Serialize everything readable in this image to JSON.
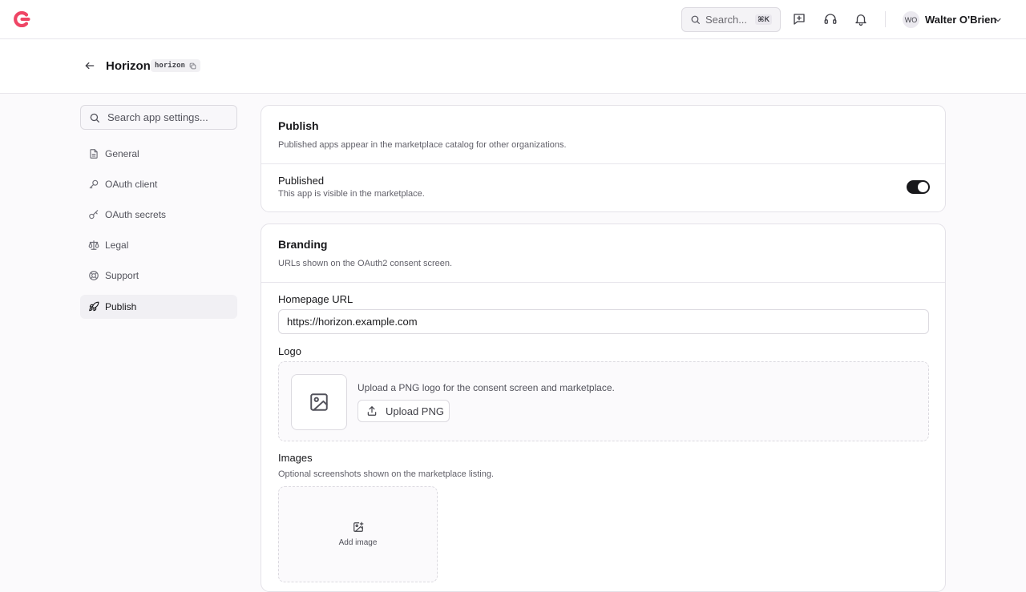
{
  "topbar": {
    "search_placeholder": "Search...",
    "search_shortcut": "⌘K",
    "user_initials": "WO",
    "user_name": "Walter O'Brien"
  },
  "header": {
    "app_name": "Horizon",
    "app_slug": "horizon"
  },
  "sidebar": {
    "search_placeholder": "Search app settings...",
    "items": [
      {
        "label": "General",
        "icon": "file-text-icon",
        "active": false
      },
      {
        "label": "OAuth client",
        "icon": "key-icon",
        "active": false
      },
      {
        "label": "OAuth secrets",
        "icon": "key-round-icon",
        "active": false
      },
      {
        "label": "Legal",
        "icon": "scale-icon",
        "active": false
      },
      {
        "label": "Support",
        "icon": "life-buoy-icon",
        "active": false
      },
      {
        "label": "Publish",
        "icon": "rocket-icon",
        "active": true
      }
    ]
  },
  "publish_card": {
    "title": "Publish",
    "description": "Published apps appear in the marketplace catalog for other organizations.",
    "published_label": "Published",
    "published_description": "This app is visible in the marketplace.",
    "published_on": true
  },
  "branding_card": {
    "title": "Branding",
    "description": "URLs shown on the OAuth2 consent screen.",
    "homepage_label": "Homepage URL",
    "homepage_value": "https://horizon.example.com",
    "logo_label": "Logo",
    "logo_hint": "Upload a PNG logo for the consent screen and marketplace.",
    "upload_label": "Upload PNG",
    "images_label": "Images",
    "images_description": "Optional screenshots shown on the marketplace listing.",
    "add_image_label": "Add image"
  },
  "colors": {
    "brand": "#ef4565",
    "toggle_on": "#18181b",
    "page_bg": "#fbfafc"
  }
}
